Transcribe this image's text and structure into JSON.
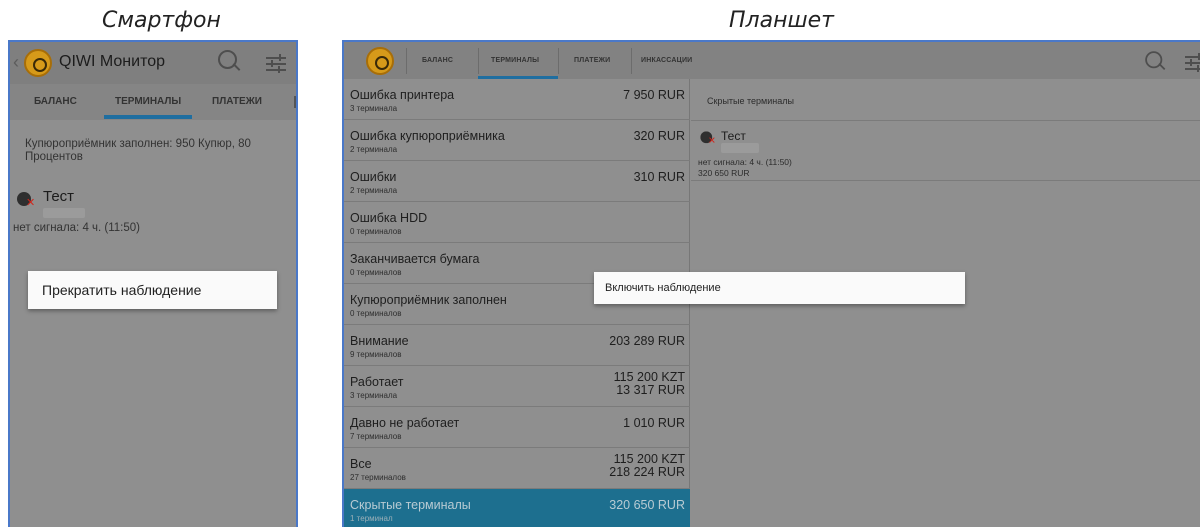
{
  "captions": {
    "phone": "Смартфон",
    "tablet": "Планшет"
  },
  "phone": {
    "app_title": "QIWI Монитор",
    "tabs": [
      "БАЛАНС",
      "ТЕРМИНАЛЫ",
      "ПЛАТЕЖИ"
    ],
    "active_tab": "ТЕРМИНАЛЫ",
    "notice": "Купюроприёмник заполнен: 950 Купюр, 80 Процентов",
    "terminal": {
      "name": "Тест",
      "status": "нет сигнала: 4 ч. (11:50)",
      "icon": "gear-error-icon"
    },
    "context_menu_item": "Прекратить наблюдение"
  },
  "tablet": {
    "tabs": [
      "БАЛАНС",
      "ТЕРМИНАЛЫ",
      "ПЛАТЕЖИ",
      "ИНКАССАЦИИ"
    ],
    "active_tab": "ТЕРМИНАЛЫ",
    "groups": [
      {
        "title": "Ошибка принтера",
        "count": "3 терминала",
        "amounts": [
          "7 950 RUR"
        ]
      },
      {
        "title": "Ошибка купюроприёмника",
        "count": "2 терминала",
        "amounts": [
          "320 RUR"
        ]
      },
      {
        "title": "Ошибки",
        "count": "2 терминала",
        "amounts": [
          "310 RUR"
        ]
      },
      {
        "title": "Ошибка HDD",
        "count": "0 терминалов",
        "amounts": []
      },
      {
        "title": "Заканчивается бумага",
        "count": "0 терминалов",
        "amounts": []
      },
      {
        "title": "Купюроприёмник заполнен",
        "count": "0 терминалов",
        "amounts": []
      },
      {
        "title": "Внимание",
        "count": "9 терминалов",
        "amounts": [
          "203 289 RUR"
        ]
      },
      {
        "title": "Работает",
        "count": "3 терминала",
        "amounts": [
          "115 200 KZT",
          "13 317 RUR"
        ]
      },
      {
        "title": "Давно не работает",
        "count": "7 терминалов",
        "amounts": [
          "1 010 RUR"
        ]
      },
      {
        "title": "Все",
        "count": "27 терминалов",
        "amounts": [
          "115 200 KZT",
          "218 224 RUR"
        ]
      },
      {
        "title": "Скрытые терминалы",
        "count": "1 терминал",
        "amounts": [
          "320 650 RUR"
        ],
        "selected": true
      }
    ],
    "detail": {
      "title": "Скрытые терминалы",
      "terminal": {
        "name": "Тест",
        "status": "нет сигнала: 4 ч. (11:50)",
        "amount": "320 650 RUR"
      }
    },
    "context_menu_item": "Включить наблюдение"
  },
  "colors": {
    "accent": "#1f6ea0",
    "selected_row": "#1d6f8f",
    "frame": "#4a78c8",
    "error_mark": "#d0261c"
  }
}
